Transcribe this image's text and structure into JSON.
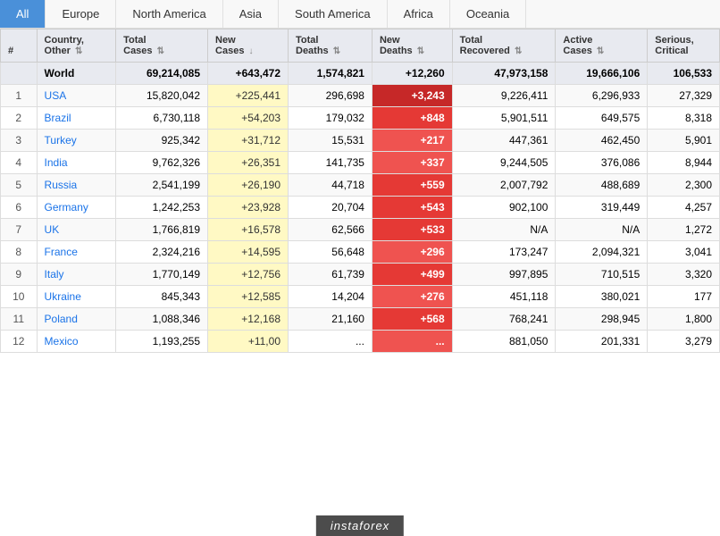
{
  "tabs": [
    {
      "label": "All",
      "active": true
    },
    {
      "label": "Europe",
      "active": false
    },
    {
      "label": "North America",
      "active": false
    },
    {
      "label": "Asia",
      "active": false
    },
    {
      "label": "South America",
      "active": false
    },
    {
      "label": "Africa",
      "active": false
    },
    {
      "label": "Oceania",
      "active": false
    }
  ],
  "columns": [
    {
      "label": "#",
      "sub": ""
    },
    {
      "label": "Country,",
      "sub": "Other"
    },
    {
      "label": "Total",
      "sub": "Cases"
    },
    {
      "label": "New",
      "sub": "Cases"
    },
    {
      "label": "Total",
      "sub": "Deaths"
    },
    {
      "label": "New",
      "sub": "Deaths"
    },
    {
      "label": "Total",
      "sub": "Recovered"
    },
    {
      "label": "Active",
      "sub": "Cases"
    },
    {
      "label": "Serious,",
      "sub": "Critical"
    }
  ],
  "world_row": {
    "country": "World",
    "total_cases": "69,214,085",
    "new_cases": "+643,472",
    "total_deaths": "1,574,821",
    "new_deaths": "+12,260",
    "total_recovered": "47,973,158",
    "active_cases": "19,666,106",
    "serious": "106,533"
  },
  "rows": [
    {
      "rank": 1,
      "country": "USA",
      "total_cases": "15,820,042",
      "new_cases": "+225,441",
      "total_deaths": "296,698",
      "new_deaths": "+3,243",
      "total_recovered": "9,226,411",
      "active_cases": "6,296,933",
      "serious": "27,329",
      "deaths_level": "darkest"
    },
    {
      "rank": 2,
      "country": "Brazil",
      "total_cases": "6,730,118",
      "new_cases": "+54,203",
      "total_deaths": "179,032",
      "new_deaths": "+848",
      "total_recovered": "5,901,511",
      "active_cases": "649,575",
      "serious": "8,318",
      "deaths_level": "dark"
    },
    {
      "rank": 3,
      "country": "Turkey",
      "total_cases": "925,342",
      "new_cases": "+31,712",
      "total_deaths": "15,531",
      "new_deaths": "+217",
      "total_recovered": "447,361",
      "active_cases": "462,450",
      "serious": "5,901",
      "deaths_level": "medium"
    },
    {
      "rank": 4,
      "country": "India",
      "total_cases": "9,762,326",
      "new_cases": "+26,351",
      "total_deaths": "141,735",
      "new_deaths": "+337",
      "total_recovered": "9,244,505",
      "active_cases": "376,086",
      "serious": "8,944",
      "deaths_level": "medium"
    },
    {
      "rank": 5,
      "country": "Russia",
      "total_cases": "2,541,199",
      "new_cases": "+26,190",
      "total_deaths": "44,718",
      "new_deaths": "+559",
      "total_recovered": "2,007,792",
      "active_cases": "488,689",
      "serious": "2,300",
      "deaths_level": "dark"
    },
    {
      "rank": 6,
      "country": "Germany",
      "total_cases": "1,242,253",
      "new_cases": "+23,928",
      "total_deaths": "20,704",
      "new_deaths": "+543",
      "total_recovered": "902,100",
      "active_cases": "319,449",
      "serious": "4,257",
      "deaths_level": "dark"
    },
    {
      "rank": 7,
      "country": "UK",
      "total_cases": "1,766,819",
      "new_cases": "+16,578",
      "total_deaths": "62,566",
      "new_deaths": "+533",
      "total_recovered": "N/A",
      "active_cases": "N/A",
      "serious": "1,272",
      "deaths_level": "dark"
    },
    {
      "rank": 8,
      "country": "France",
      "total_cases": "2,324,216",
      "new_cases": "+14,595",
      "total_deaths": "56,648",
      "new_deaths": "+296",
      "total_recovered": "173,247",
      "active_cases": "2,094,321",
      "serious": "3,041",
      "deaths_level": "medium"
    },
    {
      "rank": 9,
      "country": "Italy",
      "total_cases": "1,770,149",
      "new_cases": "+12,756",
      "total_deaths": "61,739",
      "new_deaths": "+499",
      "total_recovered": "997,895",
      "active_cases": "710,515",
      "serious": "3,320",
      "deaths_level": "dark"
    },
    {
      "rank": 10,
      "country": "Ukraine",
      "total_cases": "845,343",
      "new_cases": "+12,585",
      "total_deaths": "14,204",
      "new_deaths": "+276",
      "total_recovered": "451,118",
      "active_cases": "380,021",
      "serious": "177",
      "deaths_level": "medium"
    },
    {
      "rank": 11,
      "country": "Poland",
      "total_cases": "1,088,346",
      "new_cases": "+12,168",
      "total_deaths": "21,160",
      "new_deaths": "+568",
      "total_recovered": "768,241",
      "active_cases": "298,945",
      "serious": "1,800",
      "deaths_level": "dark"
    },
    {
      "rank": 12,
      "country": "Mexico",
      "total_cases": "1,193,255",
      "new_cases": "+11,00",
      "total_deaths": "...",
      "new_deaths": "...",
      "total_recovered": "881,050",
      "active_cases": "201,331",
      "serious": "3,279",
      "deaths_level": "medium"
    }
  ],
  "watermark": "instaforex"
}
